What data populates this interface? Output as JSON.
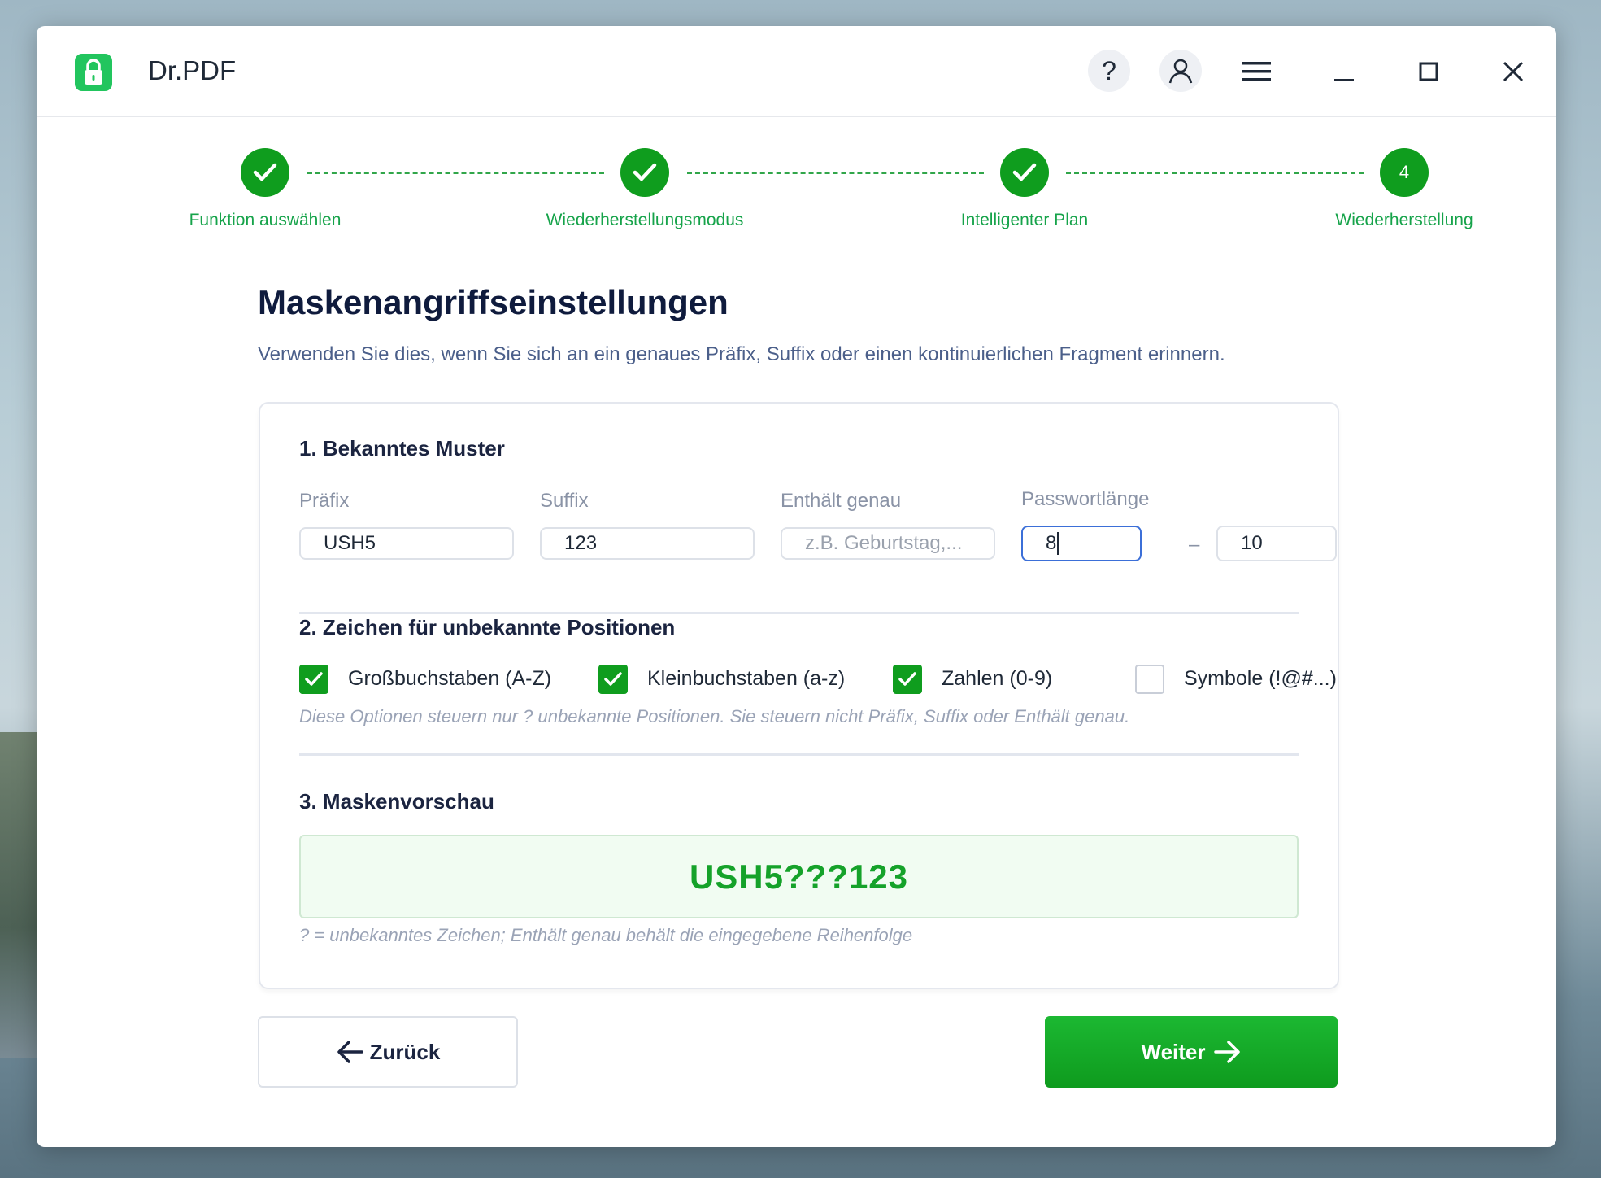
{
  "app": {
    "title": "Dr.PDF",
    "help_label": "?"
  },
  "stepper": {
    "steps": [
      {
        "label": "Funktion auswählen",
        "state": "done"
      },
      {
        "label": "Wiederherstellungsmodus",
        "state": "done"
      },
      {
        "label": "Intelligenter Plan",
        "state": "done"
      },
      {
        "label": "Wiederherstellung",
        "state": "current",
        "number": "4"
      }
    ]
  },
  "page": {
    "title": "Maskenangriffseinstellungen",
    "subtitle": "Verwenden Sie dies, wenn Sie sich an ein genaues Präfix, Suffix oder einen kontinuierlichen Fragment erinnern."
  },
  "section1": {
    "title": "1. Bekanntes Muster",
    "prefix": {
      "label": "Präfix",
      "value": "USH5"
    },
    "suffix": {
      "label": "Suffix",
      "value": "123"
    },
    "contains": {
      "label": "Enthält genau",
      "value": "",
      "placeholder": "z.B. Geburtstag,..."
    },
    "length": {
      "label": "Passwortlänge",
      "min": "8",
      "separator": "–",
      "max": "10"
    }
  },
  "section2": {
    "title": "2. Zeichen für unbekannte Positionen",
    "options": [
      {
        "label": "Großbuchstaben (A-Z)",
        "checked": true
      },
      {
        "label": "Kleinbuchstaben (a-z)",
        "checked": true
      },
      {
        "label": "Zahlen (0-9)",
        "checked": true
      },
      {
        "label": "Symbole (!@#...)",
        "checked": false
      }
    ],
    "hint": "Diese Optionen steuern nur ? unbekannte Positionen. Sie steuern nicht Präfix, Suffix oder Enthält genau."
  },
  "section3": {
    "title": "3. Maskenvorschau",
    "preview": "USH5???123",
    "hint": "? = unbekanntes Zeichen; Enthält genau behält die eingegebene Reihenfolge"
  },
  "footer": {
    "back_label": "Zurück",
    "next_label": "Weiter"
  },
  "colors": {
    "accent": "#0f9d1e",
    "step_label": "#16a34a",
    "preview_text": "#15a22a"
  }
}
